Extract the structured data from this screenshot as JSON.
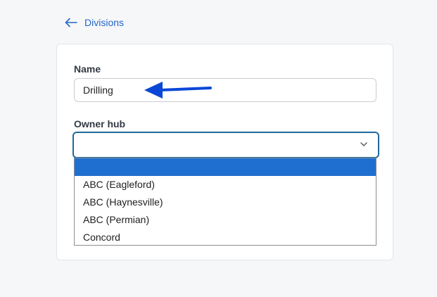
{
  "nav": {
    "back_label": "Divisions"
  },
  "form": {
    "name_label": "Name",
    "name_value": "Drilling",
    "owner_label": "Owner hub",
    "owner_value": ""
  },
  "dropdown": {
    "options": [
      "",
      "ABC (Eagleford)",
      "ABC (Haynesville)",
      "ABC (Permian)",
      "Concord"
    ],
    "selected_index": 0
  },
  "colors": {
    "accent": "#2566c8",
    "focus_border": "#1f6a99",
    "selected_option_bg": "#1f6fd0",
    "annotation_arrow": "#0a47d6"
  }
}
